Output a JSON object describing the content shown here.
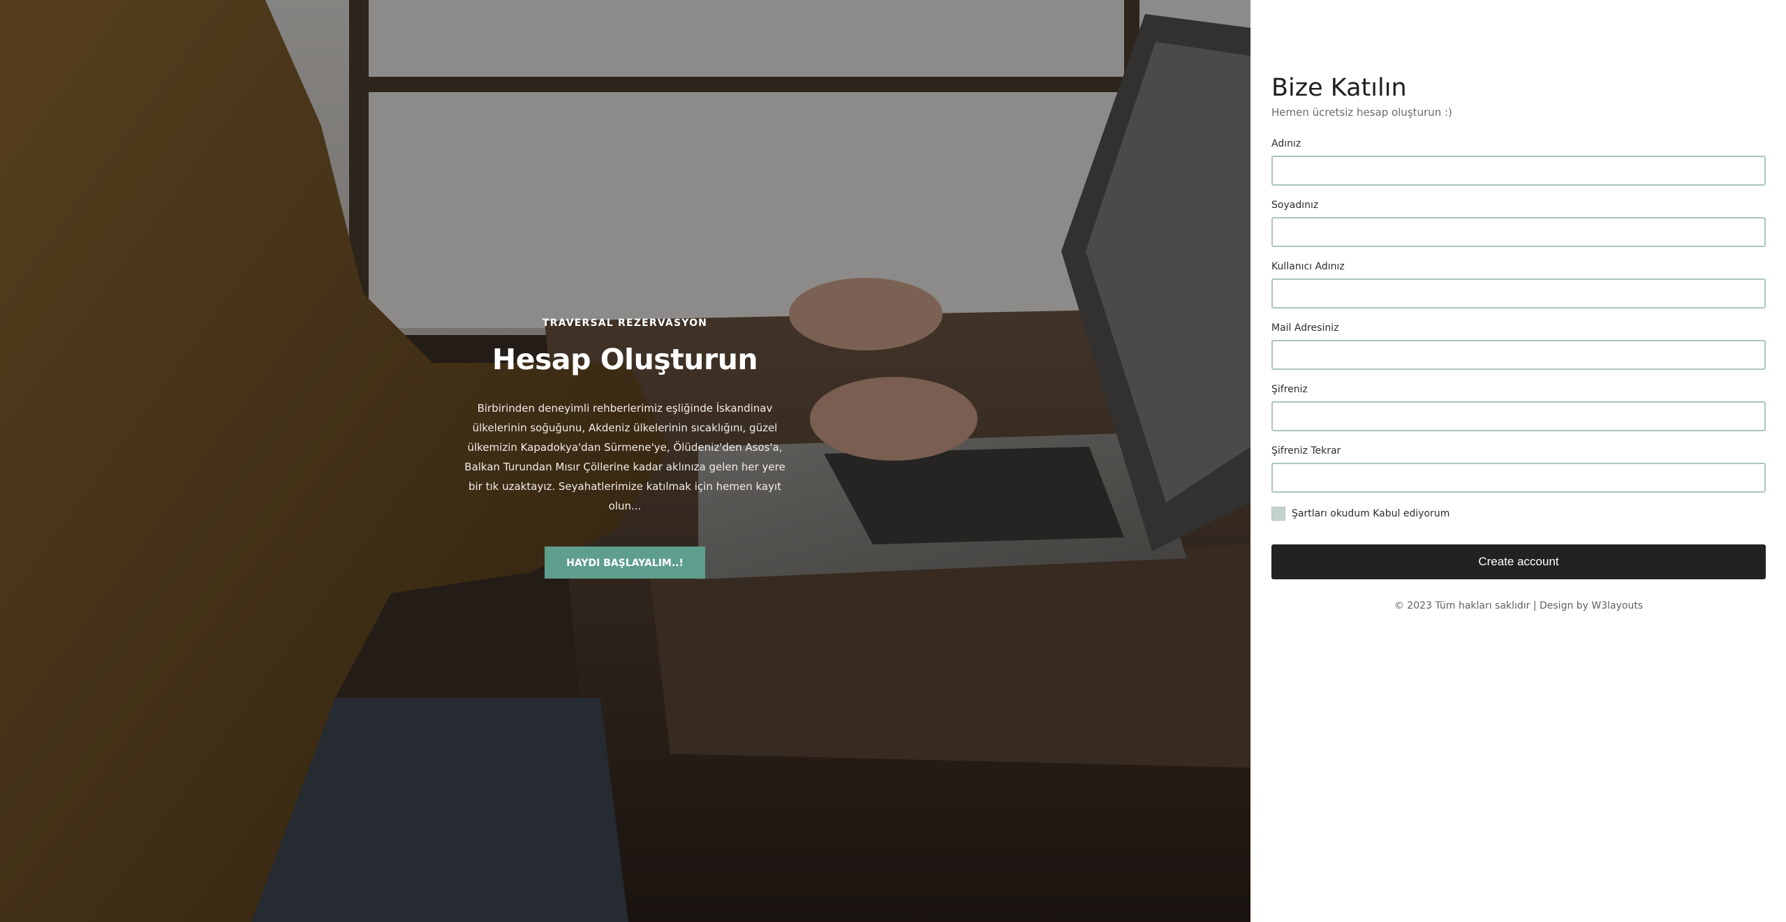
{
  "hero": {
    "kicker": "TRAVERSAL REZERVASYON",
    "title": "Hesap Oluşturun",
    "description": "Birbirinden deneyimli rehberlerimiz eşliğinde İskandinav ülkelerinin soğuğunu, Akdeniz ülkelerinin sıcaklığını, güzel ülkemizin Kapadokya'dan Sürmene'ye, Ölüdeniz'den Asos'a, Balkan Turundan Mısır Çöllerine kadar aklınıza gelen her yere bir tık uzaktayız. Seyahatlerimize katılmak için hemen kayıt olun...",
    "button_label": "HAYDI BAŞLAYALIM..!"
  },
  "form": {
    "title": "Bize Katılın",
    "subtitle": "Hemen ücretsiz hesap oluşturun :)",
    "fields": [
      {
        "label": "Adınız",
        "value": ""
      },
      {
        "label": "Soyadınız",
        "value": ""
      },
      {
        "label": "Kullanıcı Adınız",
        "value": ""
      },
      {
        "label": "Mail Adresiniz",
        "value": ""
      },
      {
        "label": "Şifreniz",
        "value": ""
      },
      {
        "label": "Şifreniz Tekrar",
        "value": ""
      }
    ],
    "terms_label": "Şartları okudum Kabul ediyorum",
    "terms_checked": false,
    "submit_label": "Create account",
    "footer": "© 2023 Tüm hakları saklıdır | Design by W3layouts"
  },
  "colors": {
    "accent": "#5e9e8c",
    "submit": "#222222",
    "input_border": "#a9c6bd"
  }
}
